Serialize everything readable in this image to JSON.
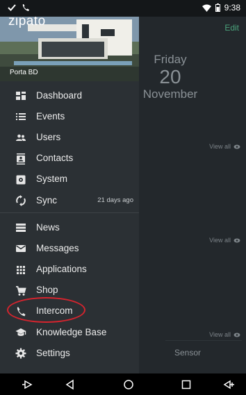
{
  "status": {
    "time": "9:38"
  },
  "app": {
    "edit_label": "Edit",
    "date": {
      "weekday": "Friday",
      "day": "20",
      "month": "November"
    },
    "view_all_label": "View all",
    "sensor_label": "Sensor"
  },
  "drawer": {
    "logo": "zipato",
    "site_name": "Porta BD",
    "group1": [
      {
        "label": "Dashboard",
        "icon": "dashboard-icon"
      },
      {
        "label": "Events",
        "icon": "list-icon"
      },
      {
        "label": "Users",
        "icon": "users-icon"
      },
      {
        "label": "Contacts",
        "icon": "contacts-icon"
      },
      {
        "label": "System",
        "icon": "system-icon"
      },
      {
        "label": "Sync",
        "icon": "sync-icon",
        "meta": "21 days ago"
      }
    ],
    "group2": [
      {
        "label": "News",
        "icon": "news-icon"
      },
      {
        "label": "Messages",
        "icon": "mail-icon"
      },
      {
        "label": "Applications",
        "icon": "apps-grid-icon"
      },
      {
        "label": "Shop",
        "icon": "cart-icon"
      },
      {
        "label": "Intercom",
        "icon": "phone-icon"
      },
      {
        "label": "Knowledge Base",
        "icon": "school-icon"
      },
      {
        "label": "Settings",
        "icon": "gear-icon"
      }
    ]
  },
  "colors": {
    "accent": "#4ba37c",
    "drawer_bg": "#2b3034",
    "highlight": "#d6242e"
  }
}
